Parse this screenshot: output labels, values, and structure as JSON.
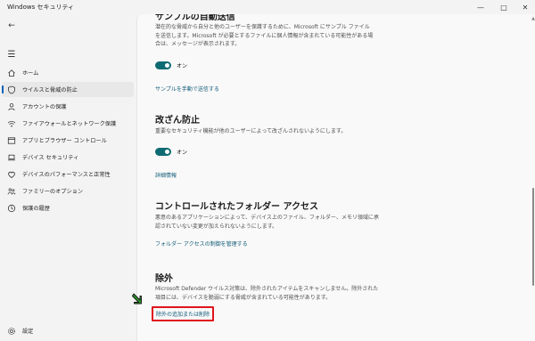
{
  "window": {
    "title": "Windows セキュリティ",
    "controls": [
      "—",
      "□",
      "✕"
    ]
  },
  "sidebar": {
    "items": [
      {
        "label": "ホーム",
        "icon": "home-icon"
      },
      {
        "label": "ウイルスと脅威の防止",
        "icon": "shield-icon",
        "active": true
      },
      {
        "label": "アカウントの保護",
        "icon": "person-icon"
      },
      {
        "label": "ファイアウォールとネットワーク保護",
        "icon": "wifi-icon"
      },
      {
        "label": "アプリとブラウザー コントロール",
        "icon": "app-window-icon"
      },
      {
        "label": "デバイス セキュリティ",
        "icon": "laptop-icon"
      },
      {
        "label": "デバイスのパフォーマンスと正常性",
        "icon": "heart-icon"
      },
      {
        "label": "ファミリーのオプション",
        "icon": "family-icon"
      },
      {
        "label": "保護の履歴",
        "icon": "history-icon"
      }
    ],
    "settings_label": "設定"
  },
  "content": {
    "sample": {
      "heading": "サンプルの自動送信",
      "desc": "潜在的な脅威から自分と他のユーザーを保護するために、Microsoft にサンプル ファイルを送信します。Microsoft が必要とするファイルに個人情報が含まれている可能性がある場合は、メッセージが表示されます。",
      "toggle_label": "オン",
      "link": "サンプルを手動で送信する"
    },
    "tamper": {
      "heading": "改ざん防止",
      "desc": "重要なセキュリティ機能が他のユーザーによって改ざんされないようにします。",
      "toggle_label": "オン",
      "link": "詳細情報"
    },
    "folder": {
      "heading": "コントロールされたフォルダー アクセス",
      "desc": "悪意のあるアプリケーションによって、デバイス上のファイル、フォルダー、メモリ領域に承認されていない変更が加えられないようにします。",
      "link": "フォルダー アクセスの制御を管理する"
    },
    "exclusions": {
      "heading": "除外",
      "desc": "Microsoft Defender ウイルス対策は、除外されたアイテムをスキャンしません。除外された項目には、デバイスを脆弱にする脅威が含まれている可能性があります。",
      "link": "除外の追加または削除"
    }
  },
  "colors": {
    "accent_toggle": "#0f6b73",
    "link": "#0f5b78",
    "highlight_box": "#e0141e",
    "arrow": "#2e9a2e",
    "active_indicator": "#005fb8"
  }
}
